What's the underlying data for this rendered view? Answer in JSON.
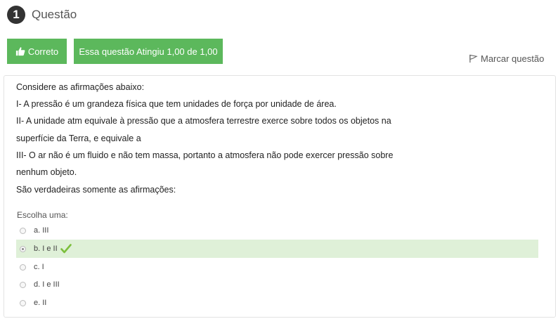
{
  "question": {
    "number": "1",
    "title": "Questão"
  },
  "status": {
    "correct_label": "Correto",
    "grade_label": "Essa questão Atingiu 1,00 de 1,00",
    "flag_label": "Marcar questão"
  },
  "statement": [
    "Considere as afirmações abaixo:",
    "I- A pressão é um grandeza física que tem unidades de força por unidade de área.",
    "II- A unidade atm equivale à pressão que a atmosfera terrestre exerce sobre todos os objetos na",
    "superfície da Terra, e equivale a",
    "III- O ar não é um fluido e não tem massa, portanto a atmosfera não pode exercer pressão sobre",
    "nenhum objeto.",
    "São verdadeiras somente as afirmações:"
  ],
  "answer": {
    "prompt": "Escolha uma:",
    "options": [
      {
        "label": "a. III",
        "selected": false
      },
      {
        "label": "b. I e II",
        "selected": true,
        "correct": true
      },
      {
        "label": "c. I",
        "selected": false
      },
      {
        "label": "d. I e III",
        "selected": false
      },
      {
        "label": "e. II",
        "selected": false
      }
    ]
  },
  "colors": {
    "success_green": "#5cb85c",
    "selected_bg": "#dff0d8",
    "check_green": "#7cbf3c"
  }
}
